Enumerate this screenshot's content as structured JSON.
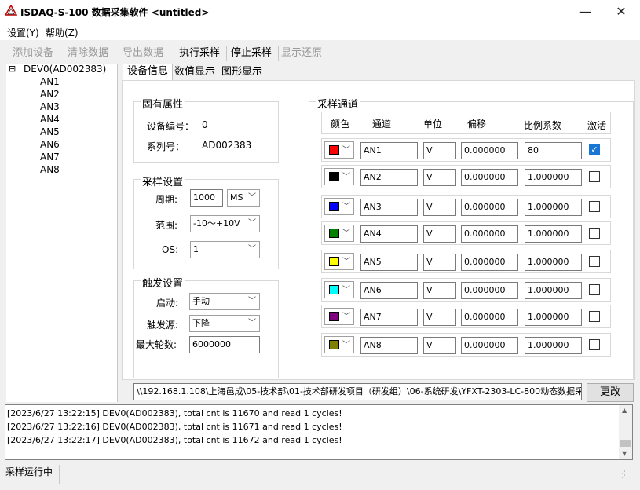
{
  "window": {
    "title": "ISDAQ-S-100 数据采集软件 <untitled>",
    "minimize": "—",
    "close": "✕"
  },
  "menu": [
    "设置(Y)",
    "帮助(Z)"
  ],
  "toolbar": [
    {
      "label": "添加设备",
      "enabled": false
    },
    {
      "label": "清除数据",
      "enabled": false
    },
    {
      "label": "导出数据",
      "enabled": false
    },
    {
      "label": "执行采样",
      "enabled": true
    },
    {
      "label": "停止采样",
      "enabled": true
    },
    {
      "label": "显示还原",
      "enabled": false
    }
  ],
  "tree": {
    "expander": "⊟",
    "root": "DEV0(AD002383)",
    "children": [
      "AN1",
      "AN2",
      "AN3",
      "AN4",
      "AN5",
      "AN6",
      "AN7",
      "AN8"
    ]
  },
  "tabs": [
    "设备信息",
    "数值显示",
    "图形显示"
  ],
  "fixed_props": {
    "title": "固有属性",
    "device_no_label": "设备编号：",
    "device_no": "0",
    "serial_label": "系列号：",
    "serial": "AD002383"
  },
  "sampling": {
    "title": "采样设置",
    "period_label": "周期:",
    "period": "1000",
    "period_unit": "MS",
    "range_label": "范围:",
    "range": "-10～+10V",
    "os_label": "OS:",
    "os": "1"
  },
  "trigger": {
    "title": "触发设置",
    "start_label": "启动:",
    "start": "手动",
    "source_label": "触发源:",
    "source": "下降",
    "max_rounds_label": "最大轮数:",
    "max_rounds": "6000000"
  },
  "channels": {
    "title": "采样通道",
    "headers": [
      "颜色",
      "通道",
      "单位",
      "偏移",
      "比例系数",
      "激活"
    ],
    "rows": [
      {
        "color": "#ff0000",
        "name": "AN1",
        "unit": "V",
        "offset": "0.000000",
        "scale": "80",
        "active": true
      },
      {
        "color": "#000000",
        "name": "AN2",
        "unit": "V",
        "offset": "0.000000",
        "scale": "1.000000",
        "active": false
      },
      {
        "color": "#0000ff",
        "name": "AN3",
        "unit": "V",
        "offset": "0.000000",
        "scale": "1.000000",
        "active": false
      },
      {
        "color": "#008000",
        "name": "AN4",
        "unit": "V",
        "offset": "0.000000",
        "scale": "1.000000",
        "active": false
      },
      {
        "color": "#ffff00",
        "name": "AN5",
        "unit": "V",
        "offset": "0.000000",
        "scale": "1.000000",
        "active": false
      },
      {
        "color": "#00ffff",
        "name": "AN6",
        "unit": "V",
        "offset": "0.000000",
        "scale": "1.000000",
        "active": false
      },
      {
        "color": "#800080",
        "name": "AN7",
        "unit": "V",
        "offset": "0.000000",
        "scale": "1.000000",
        "active": false
      },
      {
        "color": "#808000",
        "name": "AN8",
        "unit": "V",
        "offset": "0.000000",
        "scale": "1.000000",
        "active": false
      }
    ]
  },
  "path": "\\\\192.168.1.108\\上海邑成\\05-技术部\\01-技术部研发项目（研发组）\\06-系统研发\\YFXT-2303-LC-800动态数据采",
  "change_button": "更改",
  "log": [
    "[2023/6/27 13:22:15] DEV0(AD002383), total cnt is 11670 and read 1 cycles!",
    "[2023/6/27 13:22:16] DEV0(AD002383), total cnt is 11671 and read 1 cycles!",
    "[2023/6/27 13:22:17] DEV0(AD002383), total cnt is 11672 and read 1 cycles!"
  ],
  "status": "采样运行中"
}
